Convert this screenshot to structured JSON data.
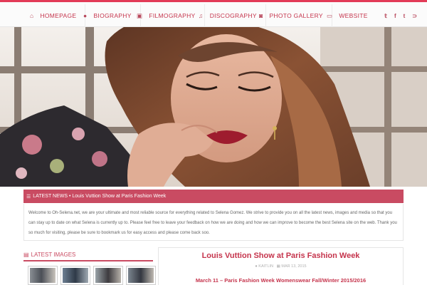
{
  "nav": {
    "items": [
      {
        "label": "HOMEPAGE",
        "icon": "home-icon",
        "glyph": "⌂"
      },
      {
        "label": "BIOGRAPHY",
        "icon": "user-icon",
        "glyph": "●"
      },
      {
        "label": "FILMOGRAPHY",
        "icon": "film-icon",
        "glyph": "▣"
      },
      {
        "label": "DISCOGRAPHY",
        "icon": "music-icon",
        "glyph": "♫"
      },
      {
        "label": "PHOTO GALLERY",
        "icon": "camera-icon",
        "glyph": "◙"
      },
      {
        "label": "WEBSITE",
        "icon": "laptop-icon",
        "glyph": "▭"
      }
    ],
    "social": [
      {
        "name": "twitter-icon",
        "glyph": "𝕥"
      },
      {
        "name": "facebook-icon",
        "glyph": "f"
      },
      {
        "name": "tumblr-icon",
        "glyph": "t"
      },
      {
        "name": "rss-icon",
        "glyph": "⊃"
      }
    ]
  },
  "news": {
    "label": "LATEST NEWS",
    "headline": "Louis Vuttion Show at Paris Fashion Week"
  },
  "welcome": {
    "text": "Welcome to Oh-Selena.net, we are your ultimate and most reliable source for everything related to Selena Gomez. We strive to provide you on all the latest news, images and media so that you can stay up to date on what Selena is currently up to. Please feel free to leave your feedback on how we are doing and how we can improve to become the best Selena site on the web. Thank you so much for visiting, please be sure to bookmark us for easy access and please come back soo."
  },
  "latest_images": {
    "title": "LATEST IMAGES"
  },
  "post": {
    "title": "Louis Vuttion Show at Paris Fashion Week",
    "author": "KAITLIN",
    "date": "MAR 13, 2015",
    "subtitle": "March 11 – Paris Fashion Week Womenswear Fall/Winter 2015/2016"
  },
  "colors": {
    "accent": "#c94b62",
    "nav_text": "#c5344c"
  }
}
